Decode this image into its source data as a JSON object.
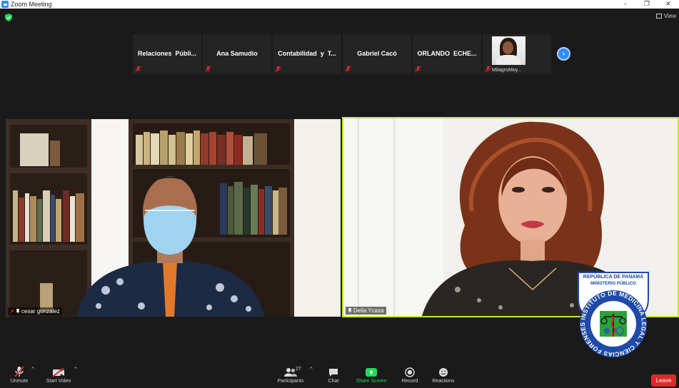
{
  "window": {
    "title": "Zoom Meeting",
    "controls": [
      "–",
      "❐",
      "✕"
    ]
  },
  "header": {
    "view_label": "View"
  },
  "gallery_strip": {
    "tiles": [
      {
        "name": "Relaciones  Públi...",
        "muted": true
      },
      {
        "name": "Ana Samudio",
        "muted": true
      },
      {
        "name": "Contabilidad  y  T...",
        "muted": true
      },
      {
        "name": "Gabriel Cacó",
        "muted": true
      },
      {
        "name": "ORLANDO  ECHE...",
        "muted": true
      },
      {
        "name": "MilagroMoy...",
        "muted": true,
        "has_video": true
      }
    ],
    "next_icon": "chevron-right-icon"
  },
  "videos": {
    "left": {
      "name": "cesar gonzalez",
      "muted": true,
      "pinned": true
    },
    "right": {
      "name": "Delia Ycaza",
      "pinned": true,
      "active_speaker": true,
      "speaker_color": "#c3e62e"
    }
  },
  "logo": {
    "top_text": "REPÚBLICA DE PANAMÁ",
    "sub_text": "MINISTERIO PÚBLICO",
    "ring_text": "INSTITUTO DE MEDICINA LEGAL Y CIENCIAS FORENSES"
  },
  "toolbar": {
    "unmute_label": "Unmute",
    "start_video_label": "Start Video",
    "participants_label": "Participants",
    "participants_count": "27",
    "chat_label": "Chat",
    "share_label": "Share Screen",
    "record_label": "Record",
    "reactions_label": "Reactions",
    "leave_label": "Leave"
  },
  "colors": {
    "accent": "#2d8cff",
    "share_green": "#23d959",
    "leave_red": "#e02828",
    "mute_red": "#e02828"
  }
}
